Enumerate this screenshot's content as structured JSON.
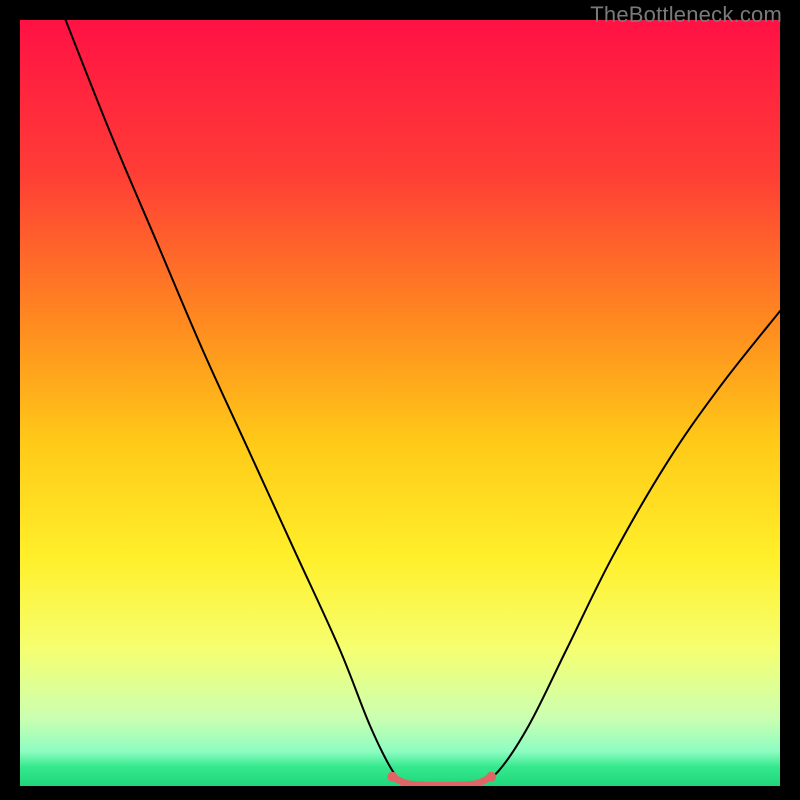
{
  "watermark": "TheBottleneck.com",
  "chart_data": {
    "type": "line",
    "title": "",
    "xlabel": "",
    "ylabel": "",
    "xlim": [
      0,
      100
    ],
    "ylim": [
      0,
      100
    ],
    "note": "Bottleneck-style V-curve over a red→yellow→green vertical gradient. Values are read off the shape (axes unlabeled, so units are 0–100% of plot area).",
    "gradient_stops": [
      {
        "pos": 0.0,
        "color": "#ff1144"
      },
      {
        "pos": 0.2,
        "color": "#ff3d36"
      },
      {
        "pos": 0.4,
        "color": "#ff8c1f"
      },
      {
        "pos": 0.55,
        "color": "#ffc918"
      },
      {
        "pos": 0.7,
        "color": "#ffef2a"
      },
      {
        "pos": 0.82,
        "color": "#f6ff70"
      },
      {
        "pos": 0.91,
        "color": "#ccffb0"
      },
      {
        "pos": 0.955,
        "color": "#8dfdc1"
      },
      {
        "pos": 0.975,
        "color": "#35e98e"
      },
      {
        "pos": 1.0,
        "color": "#1fd67a"
      }
    ],
    "series": [
      {
        "name": "left-branch",
        "color": "#000000",
        "x": [
          6,
          12,
          18,
          24,
          30,
          36,
          42,
          46,
          49,
          51
        ],
        "y": [
          100,
          85,
          71,
          57,
          44,
          31,
          18,
          8,
          2,
          0
        ]
      },
      {
        "name": "right-branch",
        "color": "#000000",
        "x": [
          60,
          63,
          67,
          72,
          78,
          85,
          92,
          100
        ],
        "y": [
          0,
          2,
          8,
          18,
          30,
          42,
          52,
          62
        ]
      },
      {
        "name": "valley-floor",
        "color": "#e06666",
        "x": [
          49,
          51,
          54,
          57,
          60,
          62
        ],
        "y": [
          1.2,
          0.3,
          0.1,
          0.1,
          0.3,
          1.2
        ]
      }
    ]
  }
}
